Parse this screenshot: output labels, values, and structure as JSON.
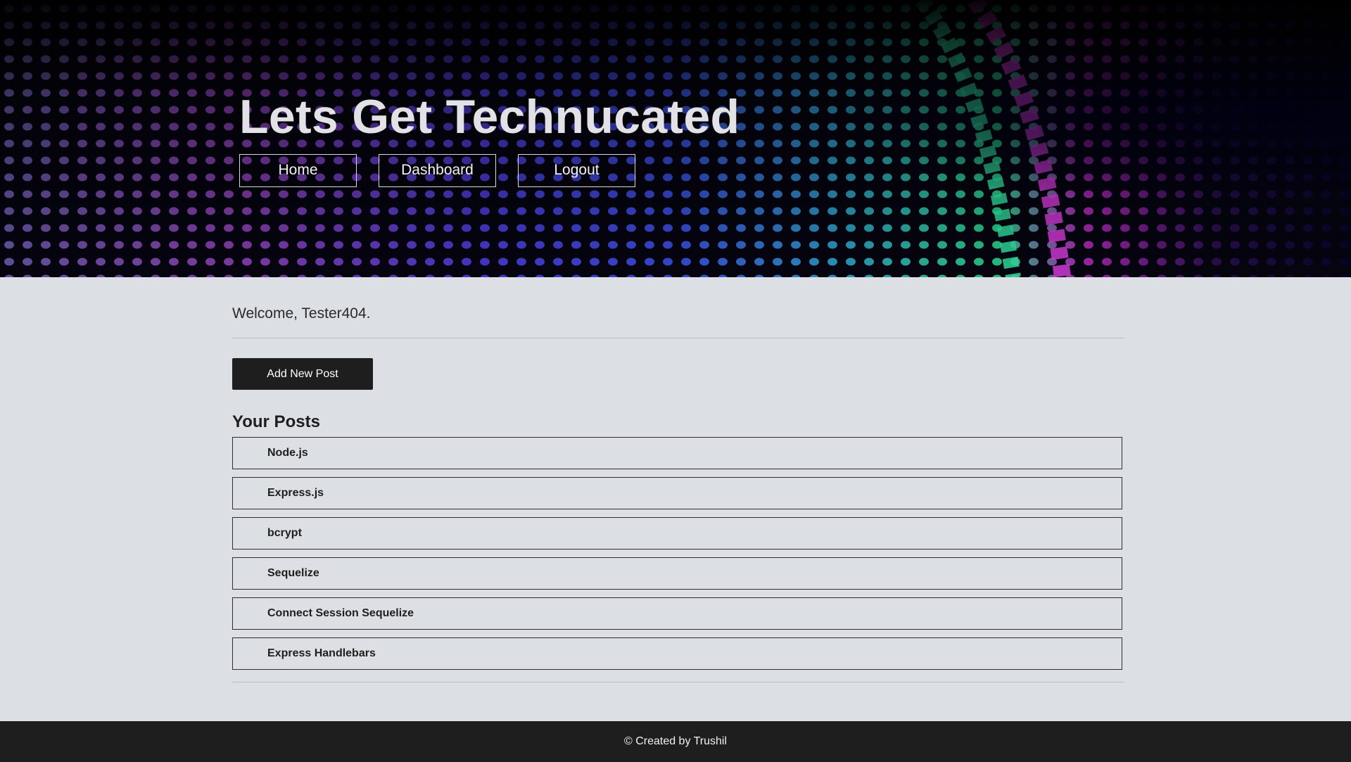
{
  "header": {
    "title": "Lets Get Technucated",
    "nav": [
      {
        "label": "Home"
      },
      {
        "label": "Dashboard"
      },
      {
        "label": "Logout"
      }
    ]
  },
  "main": {
    "welcome": "Welcome, Tester404.",
    "add_post_label": "Add New Post",
    "posts_heading": "Your Posts",
    "posts": [
      {
        "title": "Node.js"
      },
      {
        "title": "Express.js"
      },
      {
        "title": "bcrypt"
      },
      {
        "title": "Sequelize"
      },
      {
        "title": "Connect Session Sequelize"
      },
      {
        "title": "Express Handlebars"
      }
    ]
  },
  "footer": {
    "text": "© Created by Trushil"
  },
  "colors": {
    "page_background": "#dcdfe4",
    "dark": "#1e1e1e",
    "title_text": "#e1e1e6"
  }
}
